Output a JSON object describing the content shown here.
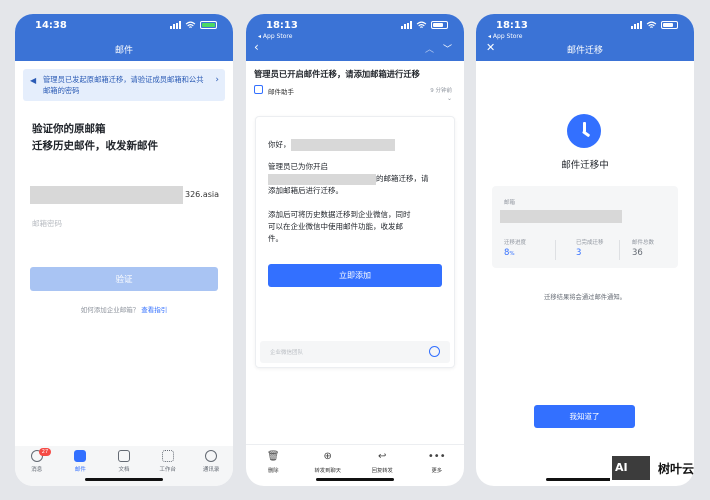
{
  "phone1": {
    "status": {
      "time": "14:38"
    },
    "nav_title": "邮件",
    "banner": "管理员已发起原邮箱迁移，请验证成员邮箱和公共邮箱的密码",
    "heading_line1": "验证你的原邮箱",
    "heading_line2": "迁移历史邮件，收发新邮件",
    "email_suffix": "326.asia",
    "password_placeholder": "邮箱密码",
    "verify_button": "验证",
    "help_text": "如何添加企业邮箱？",
    "help_link": "查看指引",
    "tabs": [
      {
        "label": "消息",
        "badge": "27"
      },
      {
        "label": "邮件"
      },
      {
        "label": "文档"
      },
      {
        "label": "工作台"
      },
      {
        "label": "通讯录"
      }
    ]
  },
  "phone2": {
    "status": {
      "time": "18:13",
      "back_app": "◂ App Store"
    },
    "subject": "管理员已开启邮件迁移，请添加邮箱进行迁移",
    "sender": "邮件助手",
    "time_ago": "9 分钟前",
    "greeting": "你好，",
    "body_line1": "管理员已为你开启",
    "body_line2_suffix": "的邮箱迁移，请",
    "body_line3": "添加邮箱后进行迁移。",
    "body_para2": [
      "添加后可将历史数据迁移到企业微信，同时",
      "可以在企业微信中使用邮件功能，收发邮",
      "件。"
    ],
    "add_button": "立即添加",
    "footer_label": "企业微信团队",
    "actions": [
      "删除",
      "转发到聊天",
      "回复转发",
      "更多"
    ]
  },
  "phone3": {
    "status": {
      "time": "18:13",
      "back_app": "◂ App Store"
    },
    "nav_title": "邮件迁移",
    "migrating_title": "邮件迁移中",
    "mailbox_label": "邮箱",
    "progress_label": "迁移进度",
    "progress_value": "8",
    "progress_unit": "%",
    "done_label": "已完成迁移",
    "done_value": "3",
    "total_label": "邮件总数",
    "total_value": "36",
    "note": "迁移结果将会通过邮件通知。",
    "ok_button": "我知道了"
  },
  "watermark": {
    "text": "树叶云"
  }
}
